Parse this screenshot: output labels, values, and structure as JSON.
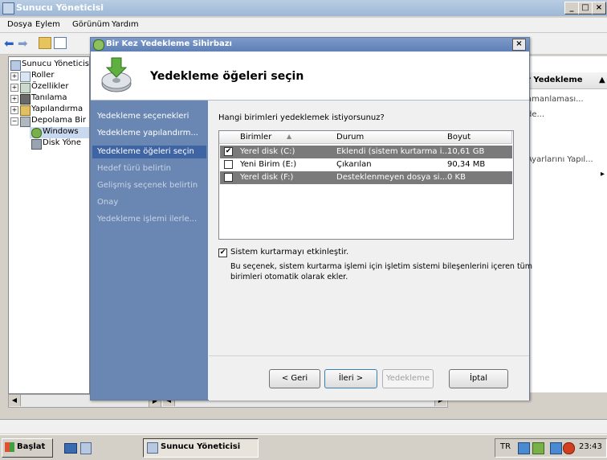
{
  "window": {
    "title": "Sunucu Yöneticisi",
    "controls": [
      "_",
      "□",
      "×"
    ]
  },
  "menu": [
    "Dosya",
    "Eylem",
    "Görünüm",
    "Yardım"
  ],
  "tree": {
    "items": [
      {
        "label": "Sunucu Yöneticisi"
      },
      {
        "label": "Roller"
      },
      {
        "label": "Özellikler"
      },
      {
        "label": "Tanılama"
      },
      {
        "label": "Yapılandırma"
      },
      {
        "label": "Depolama Bir"
      },
      {
        "label": "Windows"
      },
      {
        "label": "Disk Yöne"
      }
    ]
  },
  "right_pane": {
    "header": "r Yedekleme",
    "items": [
      "amanlaması...",
      "de...",
      "Ayarlarını Yapıl..."
    ]
  },
  "dialog": {
    "title": "Bir Kez Yedekleme Sihirbazı",
    "heading": "Yedekleme öğeleri seçin",
    "nav": [
      {
        "label": "Yedekleme seçenekleri",
        "state": "done"
      },
      {
        "label": "Yedekleme yapılandırm...",
        "state": "done"
      },
      {
        "label": "Yedekleme öğeleri seçin",
        "state": "active"
      },
      {
        "label": "Hedef türü belirtin",
        "state": "pending"
      },
      {
        "label": "Gelişmiş seçenek belirtin",
        "state": "pending"
      },
      {
        "label": "Onay",
        "state": "pending"
      },
      {
        "label": "Yedekleme işlemi ilerle...",
        "state": "pending"
      }
    ],
    "question": "Hangi birimleri yedeklemek istiyorsunuz?",
    "table": {
      "columns": [
        "Birimler",
        "Durum",
        "Boyut"
      ],
      "rows": [
        {
          "name": "Yerel disk (C:)",
          "status": "Eklendi (sistem kurtarma i...",
          "size": "10,61 GB",
          "checked": true
        },
        {
          "name": "Yeni Birim (E:)",
          "status": "Çıkarılan",
          "size": "90,34 MB",
          "checked": false
        },
        {
          "name": "Yerel disk (F:)",
          "status": "Desteklenmeyen dosya si...",
          "size": "0 KB",
          "checked": false
        }
      ]
    },
    "system_recovery": {
      "label": "Sistem kurtarmayı etkinleştir.",
      "checked": true,
      "description_line1": "Bu seçenek, sistem kurtarma işlemi için işletim sistemi bileşenlerini içeren tüm",
      "description_line2": "birimleri otomatik olarak ekler."
    },
    "buttons": {
      "back": "< Geri",
      "next": "İleri >",
      "backup": "Yedekleme",
      "cancel": "İptal"
    }
  },
  "taskbar": {
    "start": "Başlat",
    "task": "Sunucu Yöneticisi",
    "lang": "TR",
    "clock": "23:43"
  }
}
